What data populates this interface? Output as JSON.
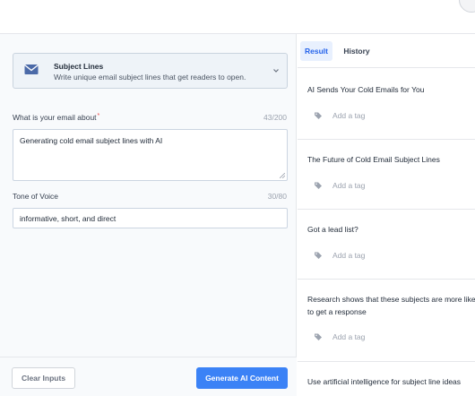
{
  "template": {
    "title": "Subject Lines",
    "description": "Write unique email subject lines that get readers to open."
  },
  "form": {
    "about": {
      "label": "What is your email about",
      "required_mark": "*",
      "count": "43/200",
      "value": "Generating cold email subject lines with AI"
    },
    "tone": {
      "label": "Tone of Voice",
      "count": "30/80",
      "value": "informative, short, and direct"
    }
  },
  "buttons": {
    "clear": "Clear Inputs",
    "generate": "Generate AI Content"
  },
  "tabs": {
    "result": "Result",
    "history": "History"
  },
  "results": [
    {
      "text": "AI Sends Your Cold Emails for You",
      "tag_placeholder": "Add a tag"
    },
    {
      "text": "The Future of Cold Email Subject Lines",
      "tag_placeholder": "Add a tag"
    },
    {
      "text": "Got a lead list?",
      "tag_placeholder": "Add a tag"
    },
    {
      "text": "Research shows that these subjects are more likely to get a response",
      "tag_placeholder": "Add a tag"
    },
    {
      "text": "Use artificial intelligence for subject line ideas"
    }
  ],
  "colors": {
    "accent": "#3b82f6",
    "active_tab_bg": "#e8f0fe"
  }
}
